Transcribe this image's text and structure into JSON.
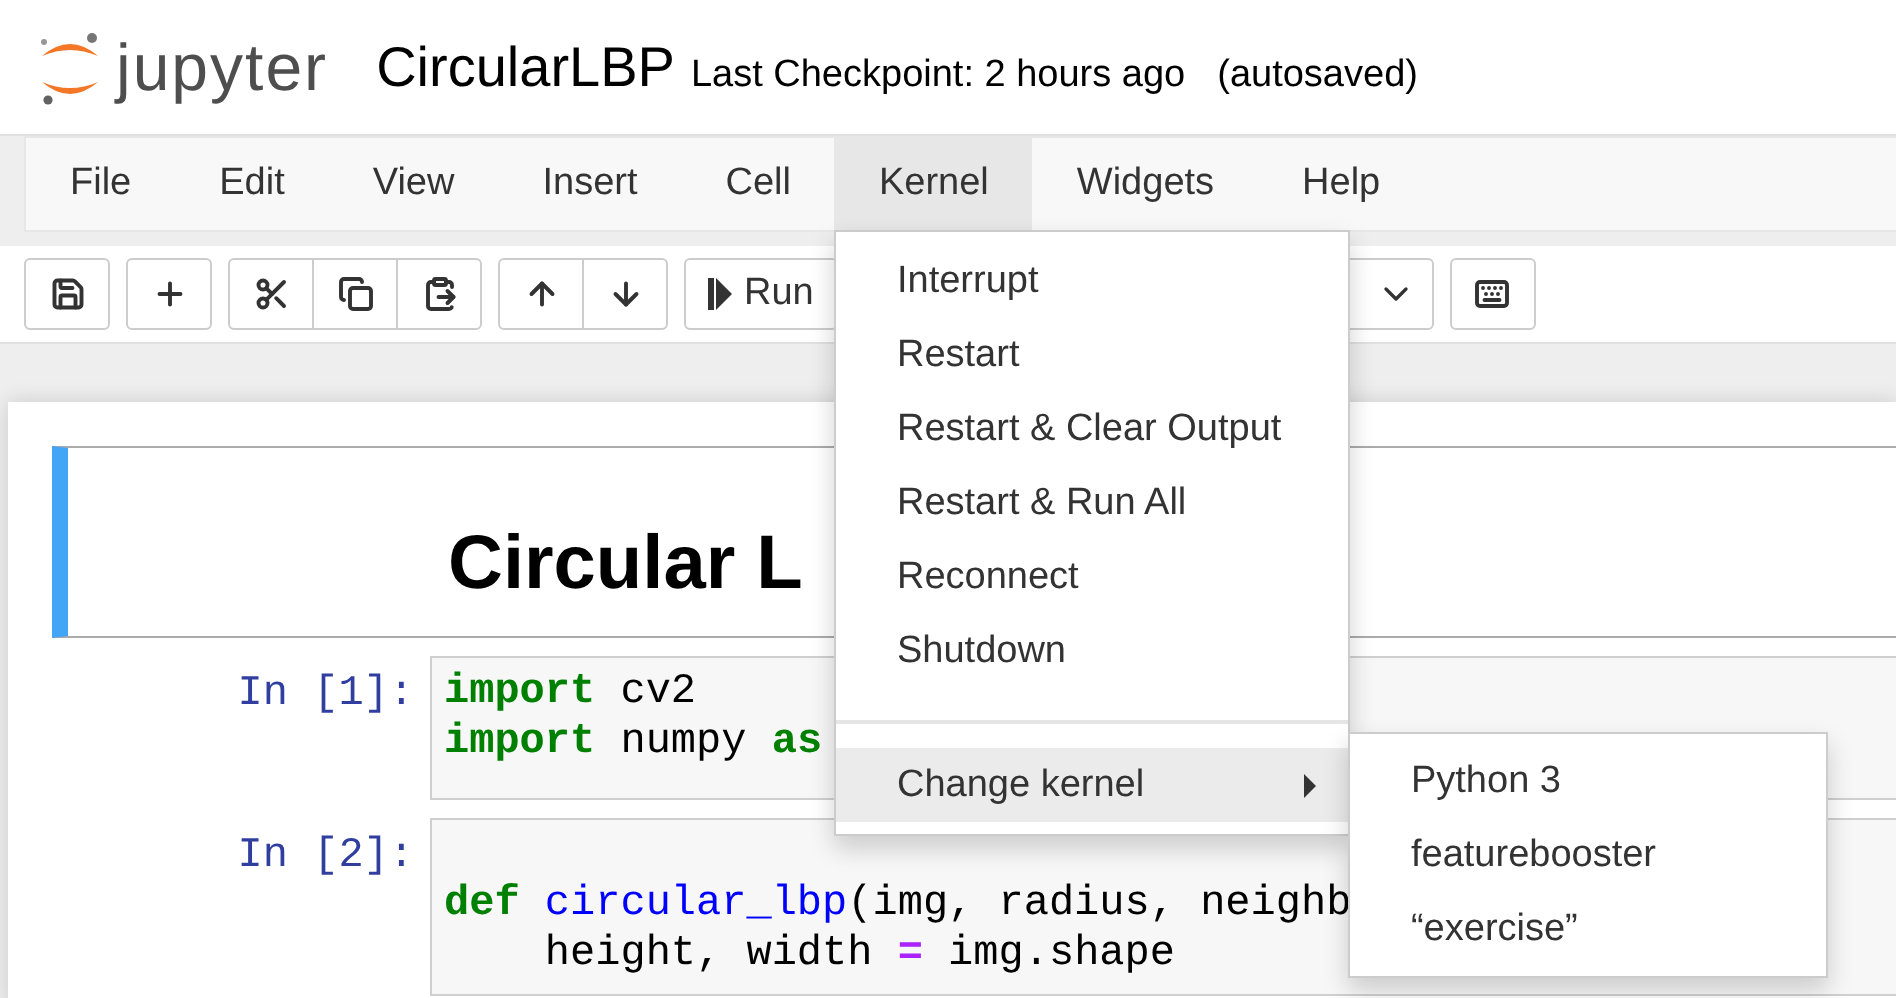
{
  "header": {
    "logo_text": "jupyter",
    "notebook_name": "CircularLBP",
    "checkpoint": "Last Checkpoint: 2 hours ago",
    "autosave": "(autosaved)"
  },
  "menubar": [
    {
      "label": "File",
      "selected": false
    },
    {
      "label": "Edit",
      "selected": false
    },
    {
      "label": "View",
      "selected": false
    },
    {
      "label": "Insert",
      "selected": false
    },
    {
      "label": "Cell",
      "selected": false
    },
    {
      "label": "Kernel",
      "selected": true
    },
    {
      "label": "Widgets",
      "selected": false
    },
    {
      "label": "Help",
      "selected": false
    }
  ],
  "kernel_menu": [
    {
      "label": "Interrupt",
      "selected": false
    },
    {
      "label": "Restart",
      "selected": false
    },
    {
      "label": "Restart & Clear Output",
      "selected": false
    },
    {
      "label": "Restart & Run All",
      "selected": false
    },
    {
      "label": "Reconnect",
      "selected": false
    },
    {
      "label": "Shutdown",
      "selected": false
    },
    {
      "kind": "divider"
    },
    {
      "label": "Change kernel",
      "selected": true,
      "submenu": [
        {
          "label": "Python 3"
        },
        {
          "label": "featurebooster"
        },
        {
          "label": "“exercise”"
        }
      ]
    }
  ],
  "toolbar": [
    [
      {
        "kind": "save"
      }
    ],
    [
      {
        "kind": "add"
      }
    ],
    [
      {
        "kind": "cut"
      },
      {
        "kind": "copy"
      },
      {
        "kind": "paste"
      }
    ],
    [
      {
        "kind": "up"
      },
      {
        "kind": "down"
      }
    ],
    [
      {
        "kind": "run",
        "label": "Run"
      }
    ],
    [
      {
        "kind": "dropdown"
      }
    ],
    [
      {
        "kind": "keyboard"
      }
    ]
  ],
  "cells": [
    {
      "kind": "heading",
      "text": "Circular L"
    },
    {
      "kind": "code",
      "prompt": "In [1]:",
      "lines": [
        {
          "tokens": [
            {
              "kind": "kw",
              "text": "import"
            },
            {
              "kind": "plain",
              "text": " cv2"
            }
          ]
        },
        {
          "tokens": [
            {
              "kind": "kw",
              "text": "import"
            },
            {
              "kind": "plain",
              "text": " numpy "
            },
            {
              "kind": "kw",
              "text": "as"
            }
          ]
        }
      ]
    },
    {
      "kind": "code",
      "prompt": "In [2]:",
      "lines": [
        {
          "kind": "blank"
        },
        {
          "tokens": [
            {
              "kind": "kw",
              "text": "def"
            },
            {
              "kind": "fn",
              "text": " circular_lbp"
            },
            {
              "kind": "plain",
              "text": "(img, radius, neighb"
            }
          ]
        },
        {
          "tokens": [
            {
              "kind": "plain",
              "text": "    height, width "
            },
            {
              "kind": "op",
              "text": "="
            },
            {
              "kind": "plain",
              "text": " img.shape"
            }
          ]
        }
      ]
    }
  ]
}
